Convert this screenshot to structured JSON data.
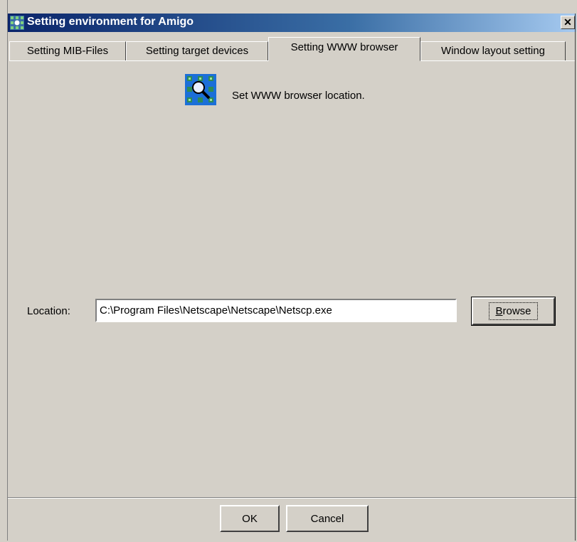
{
  "window": {
    "title": "Setting environment for Amigo",
    "close_label": "✕"
  },
  "tabs": [
    {
      "label": "Setting MIB-Files",
      "active": false
    },
    {
      "label": "Setting target devices",
      "active": false
    },
    {
      "label": "Setting WWW browser",
      "active": true
    },
    {
      "label": "Window layout setting",
      "active": false
    }
  ],
  "panel": {
    "header_icon": "browser-search-icon",
    "header_text": "Set WWW browser location.",
    "location_label": "Location:",
    "location_value": "C:\\Program Files\\Netscape\\Netscape\\Netscp.exe",
    "browse_label_accel": "B",
    "browse_label_rest": "rowse"
  },
  "footer": {
    "ok_label": "OK",
    "cancel_label": "Cancel"
  },
  "colors": {
    "titlebar_start": "#0a246a",
    "face": "#d4d0c8",
    "icon_blue": "#1b6fd8",
    "icon_green": "#2e8b57"
  }
}
